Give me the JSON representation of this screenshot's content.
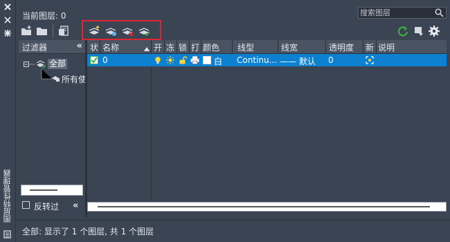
{
  "side_strip": {
    "title": "图层特性管理器",
    "icons": [
      "close-icon",
      "autohide-icon",
      "properties-icon",
      "layer-manager-icon"
    ]
  },
  "header": {
    "current_layer": "当前图层: 0",
    "search_placeholder": "搜索图层"
  },
  "toolbar": {
    "left_buttons": [
      "new-property-filter-icon",
      "new-group-filter-icon",
      "layer-states-icon"
    ],
    "layer_buttons": [
      "new-layer-icon",
      "new-layer-vp-frozen-icon",
      "delete-layer-icon",
      "set-current-icon"
    ],
    "right_buttons": [
      "refresh-icon",
      "settings-menu-icon",
      "gear-icon"
    ],
    "colors": {
      "highlight": "#e0262e",
      "refresh": "#3cb043"
    }
  },
  "filter_panel": {
    "title": "过滤器",
    "collapse": "«",
    "tree": {
      "root": "全部",
      "child": "所有使"
    },
    "invert_label": "反转过",
    "invert_checked": false
  },
  "table": {
    "columns": [
      "状",
      "名称",
      "开",
      "冻",
      "锁",
      "打",
      "颜色",
      "线型",
      "线宽",
      "透明度",
      "新",
      "说明"
    ],
    "rows": [
      {
        "status": "check-icon",
        "name": "0",
        "on": "lightbulb-icon",
        "freeze": "sun-icon",
        "lock": "unlock-icon",
        "plot": "printer-icon",
        "color_name": "白",
        "color_swatch": "#ffffff",
        "linetype": "Continu...",
        "lineweight": "—— 默认",
        "transparency": "0",
        "new_vp_freeze": "new-vp-freeze-icon",
        "description": ""
      }
    ],
    "selected_row_color": "#0d80d0"
  },
  "status_bar": {
    "text": "全部: 显示了 1 个图层, 共 1 个图层"
  }
}
